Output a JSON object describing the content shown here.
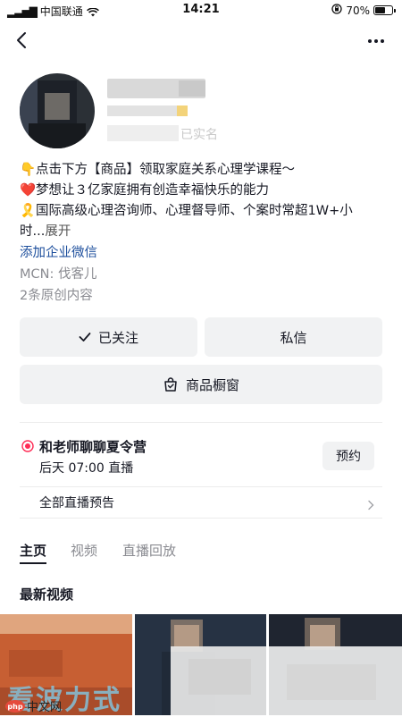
{
  "status_bar": {
    "carrier": "中国联通",
    "time": "14:21",
    "battery": "70%",
    "battery_level": 0.7
  },
  "profile": {
    "verify_suffix": "已实名",
    "bio_lines": [
      "👇点击下方【商品】领取家庭关系心理学课程～",
      "❤️梦想让３亿家庭拥有创造幸福快乐的能力",
      "🎗️国际高级心理咨询师、心理督导师、个案时常超1W+小",
      "时..."
    ],
    "bio_expand": "展开",
    "wechat_link": "添加企业微信",
    "mcn": "MCN: 伐客儿",
    "original_count": "2条原创内容"
  },
  "actions": {
    "follow_label": "已关注",
    "message_label": "私信",
    "shop_label": "商品橱窗"
  },
  "live": {
    "title": "和老师聊聊夏令营",
    "time": "后天 07:00 直播",
    "reserve_label": "预约",
    "all_label": "全部直播预告"
  },
  "tabs": [
    {
      "label": "主页",
      "active": true
    },
    {
      "label": "视频",
      "active": false
    },
    {
      "label": "直播回放",
      "active": false
    }
  ],
  "latest_videos_title": "最新视频",
  "watermark": {
    "text": "看波力式",
    "badge": "php",
    "site": "中文网"
  },
  "colors": {
    "link": "#1c4e9c",
    "live_dot": "#fe2c55",
    "button_bg": "#f1f2f3"
  }
}
